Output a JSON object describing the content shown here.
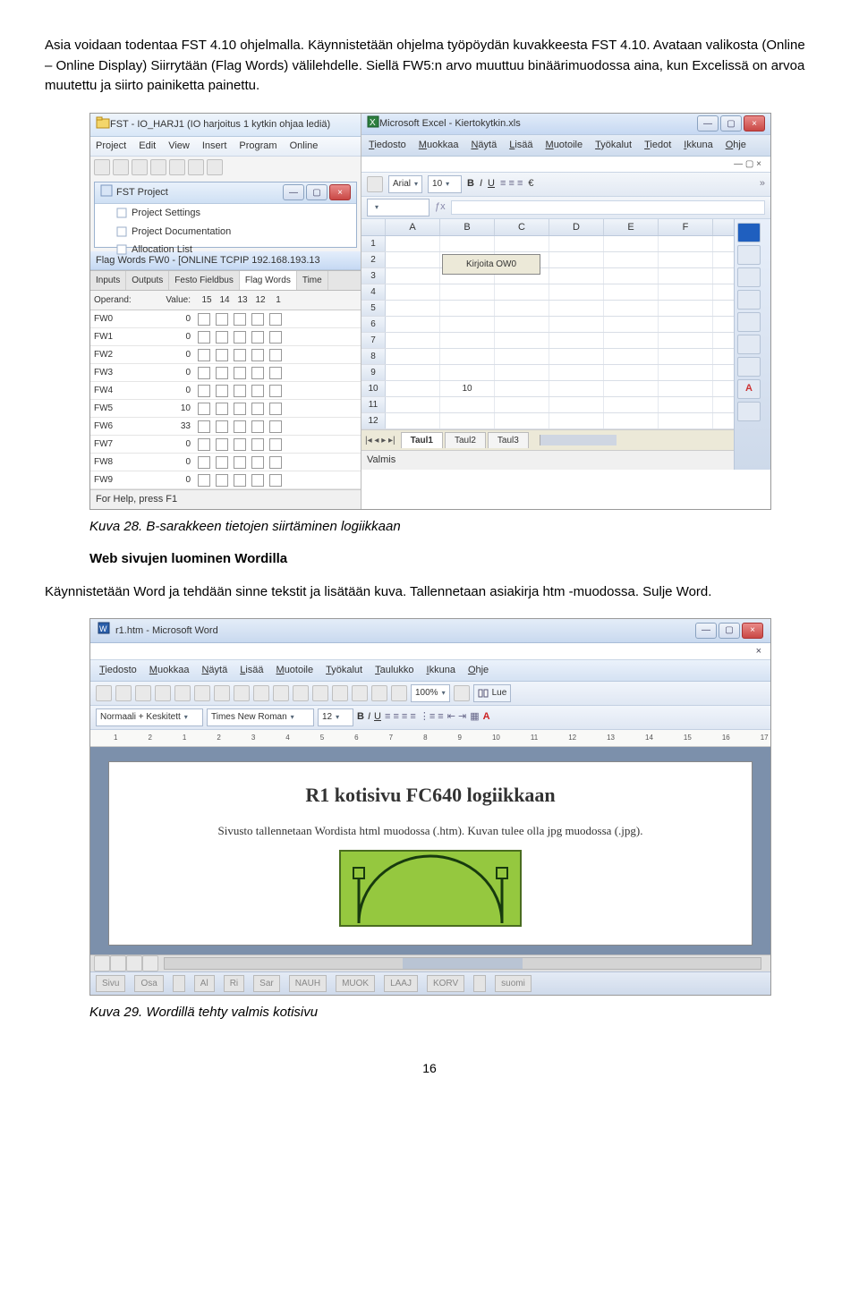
{
  "para1": "Asia voidaan todentaa FST 4.10 ohjelmalla. Käynnistetään ohjelma työpöydän kuvakkeesta FST 4.10. Avataan valikosta (Online – Online Display) Siirrytään (Flag Words) välilehdelle. Siellä FW5:n arvo muuttuu binäärimuodossa aina, kun Excelissä on arvoa muutettu ja siirto painiketta painettu.",
  "caption1": "Kuva 28. B-sarakkeen tietojen siirtäminen logiikkaan",
  "heading2": "Web sivujen luominen Wordilla",
  "para2": "Käynnistetään Word ja tehdään sinne tekstit ja lisätään kuva. Tallennetaan asiakirja htm -muodossa. Sulje Word.",
  "caption2": "Kuva 29. Wordillä tehty valmis kotisivu",
  "pagenum": "16",
  "fst": {
    "title": "FST - IO_HARJ1 (IO harjoitus 1 kytkin ohjaa lediä)",
    "menu": [
      "Project",
      "Edit",
      "View",
      "Insert",
      "Program",
      "Online"
    ],
    "project_title": "FST Project",
    "tree": [
      "Project Settings",
      "Project Documentation",
      "Allocation List"
    ],
    "flag_title": "Flag Words FW0 - [ONLINE TCPIP 192.168.193.13",
    "tabs": [
      "Inputs",
      "Outputs",
      "Festo Fieldbus",
      "Flag Words",
      "Time"
    ],
    "tabs_active": 3,
    "head": [
      "Operand:",
      "Value:",
      "15",
      "14",
      "13",
      "12",
      "1"
    ],
    "rows": [
      {
        "op": "FW0",
        "val": "0",
        "checks": [
          0,
          0,
          0,
          0,
          0
        ]
      },
      {
        "op": "FW1",
        "val": "0",
        "checks": [
          0,
          0,
          0,
          0,
          0
        ]
      },
      {
        "op": "FW2",
        "val": "0",
        "checks": [
          0,
          0,
          0,
          0,
          0
        ]
      },
      {
        "op": "FW3",
        "val": "0",
        "checks": [
          0,
          0,
          0,
          0,
          0
        ]
      },
      {
        "op": "FW4",
        "val": "0",
        "checks": [
          0,
          0,
          0,
          0,
          0
        ]
      },
      {
        "op": "FW5",
        "val": "10",
        "checks": [
          0,
          0,
          0,
          0,
          0
        ]
      },
      {
        "op": "FW6",
        "val": "33",
        "checks": [
          0,
          0,
          0,
          0,
          0
        ]
      },
      {
        "op": "FW7",
        "val": "0",
        "checks": [
          0,
          0,
          0,
          0,
          0
        ]
      },
      {
        "op": "FW8",
        "val": "0",
        "checks": [
          0,
          0,
          0,
          0,
          0
        ]
      },
      {
        "op": "FW9",
        "val": "0",
        "checks": [
          0,
          0,
          0,
          0,
          0
        ]
      }
    ],
    "status": "For Help, press F1"
  },
  "excel": {
    "title": "Microsoft Excel - Kiertokytkin.xls",
    "menu": [
      "Tiedosto",
      "Muokkaa",
      "Näytä",
      "Lisää",
      "Muotoile",
      "Työkalut",
      "Tiedot",
      "Ikkuna",
      "Ohje"
    ],
    "font": "Arial",
    "size": "10",
    "cols": [
      "A",
      "B",
      "C",
      "D",
      "E",
      "F"
    ],
    "button_text": "Kirjoita OW0",
    "value_cell": "10",
    "sheets": [
      "Taul1",
      "Taul2",
      "Taul3"
    ],
    "status": "Valmis"
  },
  "word": {
    "title": "r1.htm - Microsoft Word",
    "menu": [
      "Tiedosto",
      "Muokkaa",
      "Näytä",
      "Lisää",
      "Muotoile",
      "Työkalut",
      "Taulukko",
      "Ikkuna",
      "Ohje"
    ],
    "style": "Normaali + Keskitett",
    "font": "Times New Roman",
    "size": "12",
    "zoom": "100%",
    "lue": "Lue",
    "ruler": [
      "1",
      "2",
      "1",
      "2",
      "3",
      "4",
      "5",
      "6",
      "7",
      "8",
      "9",
      "10",
      "11",
      "12",
      "13",
      "14",
      "15",
      "16",
      "17"
    ],
    "doc_title": "R1 kotisivu FC640 logiikkaan",
    "doc_text": "Sivusto tallennetaan Wordista html muodossa (.htm). Kuvan tulee olla jpg muodossa (.jpg).",
    "status": [
      "Sivu",
      "Osa",
      "",
      "Al",
      "Ri",
      "Sar",
      "NAUH",
      "MUOK",
      "LAAJ",
      "KORV",
      "",
      "suomi"
    ]
  }
}
